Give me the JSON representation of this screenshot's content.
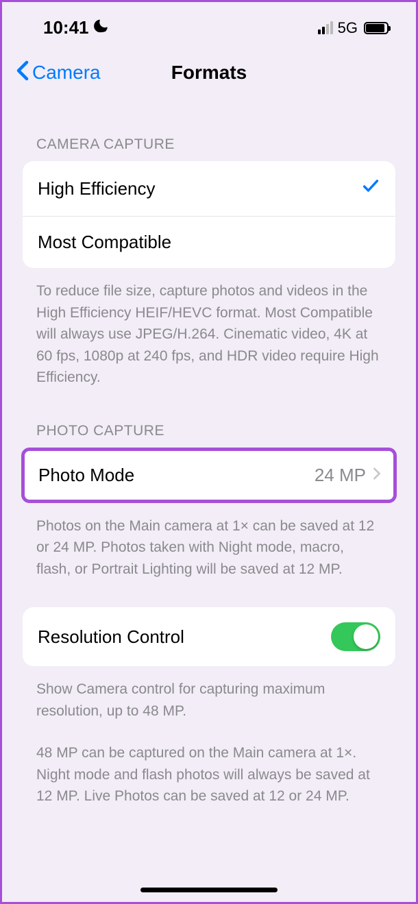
{
  "status": {
    "time": "10:41",
    "network": "5G"
  },
  "nav": {
    "back_label": "Camera",
    "title": "Formats"
  },
  "sections": {
    "camera_capture": {
      "header": "CAMERA CAPTURE",
      "options": [
        {
          "label": "High Efficiency",
          "selected": true
        },
        {
          "label": "Most Compatible",
          "selected": false
        }
      ],
      "footer": "To reduce file size, capture photos and videos in the High Efficiency HEIF/HEVC format. Most Compatible will always use JPEG/H.264. Cinematic video, 4K at 60 fps, 1080p at 240 fps, and HDR video require High Efficiency."
    },
    "photo_capture": {
      "header": "PHOTO CAPTURE",
      "photo_mode": {
        "label": "Photo Mode",
        "value": "24 MP"
      },
      "footer": "Photos on the Main camera at 1× can be saved at 12 or 24 MP. Photos taken with Night mode, macro, flash, or Portrait Lighting will be saved at 12 MP."
    },
    "resolution": {
      "label": "Resolution Control",
      "enabled": true,
      "footer1": "Show Camera control for capturing maximum resolution, up to 48 MP.",
      "footer2": "48 MP can be captured on the Main camera at 1×. Night mode and flash photos will always be saved at 12 MP. Live Photos can be saved at 12 or 24 MP."
    }
  }
}
